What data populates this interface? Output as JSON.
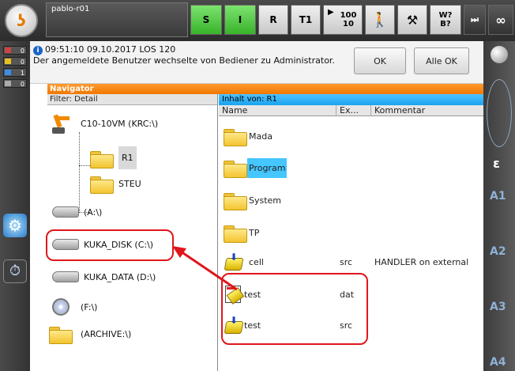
{
  "topbar": {
    "robot_name": "pablo-r01",
    "buttons": {
      "s": "S",
      "i": "I",
      "r": "R",
      "t1": "T1",
      "override_top": "100",
      "override_bottom": "10",
      "wb_top": "W?",
      "wb_bottom": "B?",
      "infinity": "∞"
    }
  },
  "message": {
    "header": "09:51:10 09.10.2017 LOS 120",
    "text": "Der angemeldete Benutzer wechselte von Bediener zu Administrator.",
    "ok_label": "OK",
    "all_ok_label": "Alle OK"
  },
  "message_counts": [
    "0",
    "0",
    "1",
    "0"
  ],
  "navigator": {
    "title": "Navigator",
    "filter": "Filter: Detail",
    "content_of": "Inhalt von: R1",
    "columns": [
      "Name",
      "Ex...",
      "Kommentar"
    ],
    "tree": [
      {
        "label": "C10-10VM (KRC:\\)"
      },
      {
        "label": "R1"
      },
      {
        "label": "STEU"
      },
      {
        "label": "(A:\\)"
      },
      {
        "label": "KUKA_DISK (C:\\)"
      },
      {
        "label": "KUKA_DATA (D:\\)"
      },
      {
        "label": "(F:\\)"
      },
      {
        "label": "(ARCHIVE:\\)"
      }
    ],
    "files": [
      {
        "name": "Mada",
        "ext": "",
        "comment": ""
      },
      {
        "name": "Program",
        "ext": "",
        "comment": ""
      },
      {
        "name": "System",
        "ext": "",
        "comment": ""
      },
      {
        "name": "TP",
        "ext": "",
        "comment": ""
      },
      {
        "name": "cell",
        "ext": "src",
        "comment": "HANDLER on external"
      },
      {
        "name": "test",
        "ext": "dat",
        "comment": ""
      },
      {
        "name": "test",
        "ext": "src",
        "comment": ""
      }
    ]
  },
  "right_strip": {
    "axis_labels": [
      "A1",
      "A2",
      "A3",
      "A4"
    ]
  },
  "colors": {
    "accent_orange": "#f07800",
    "selection_blue": "#45c6ff",
    "annotation_red": "#e0161b",
    "status_green": "#37b32a"
  }
}
